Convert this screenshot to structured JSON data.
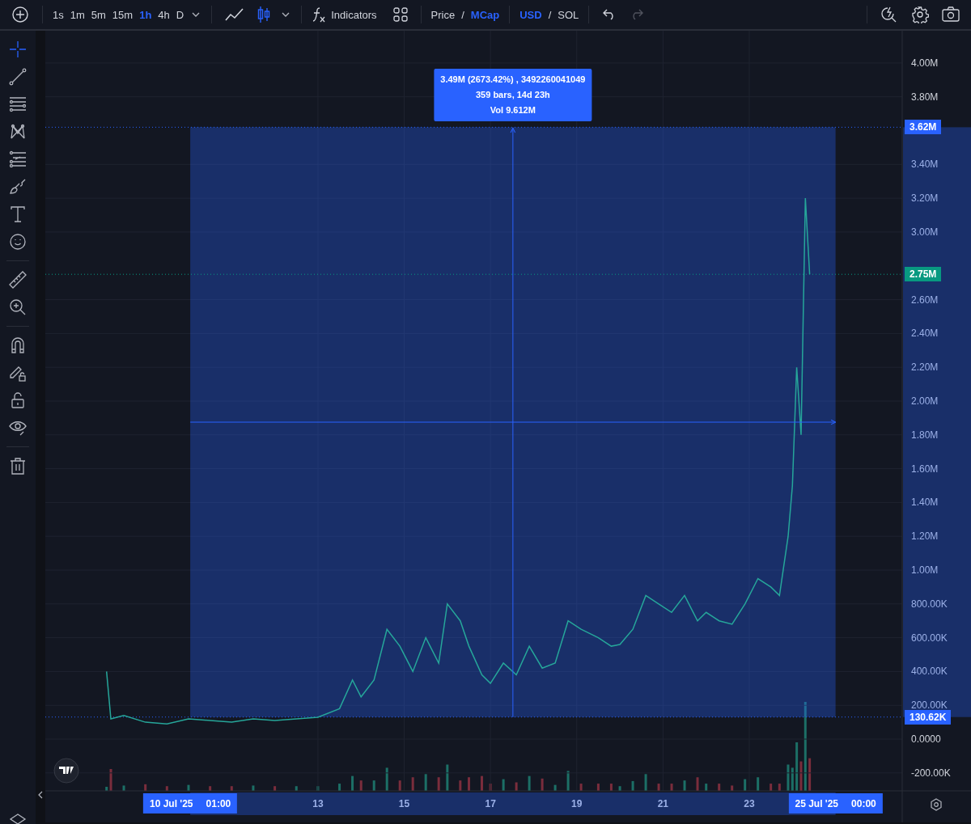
{
  "toolbar": {
    "intervals": [
      {
        "label": "1s",
        "selected": false
      },
      {
        "label": "1m",
        "selected": false
      },
      {
        "label": "5m",
        "selected": false
      },
      {
        "label": "15m",
        "selected": false
      },
      {
        "label": "1h",
        "selected": true
      },
      {
        "label": "4h",
        "selected": false
      },
      {
        "label": "D",
        "selected": false
      }
    ],
    "chart_types": [
      {
        "kind": "line",
        "selected": false
      },
      {
        "kind": "candles",
        "selected": true
      }
    ],
    "indicators_label": "Indicators",
    "value_modes": [
      {
        "label": "Price",
        "selected": false
      },
      {
        "label": "MCap",
        "selected": true
      }
    ],
    "value_separator": "/",
    "currencies": [
      {
        "label": "USD",
        "selected": true
      },
      {
        "label": "SOL",
        "selected": false
      }
    ],
    "currency_separator": "/",
    "undo": {
      "disabled": false
    },
    "redo": {
      "disabled": true
    }
  },
  "tool_groups": [
    [
      {
        "kind": "crosshair",
        "selected": true
      },
      {
        "kind": "trend-line",
        "selected": false
      },
      {
        "kind": "horizontal-lines",
        "selected": false
      },
      {
        "kind": "pattern",
        "selected": false
      },
      {
        "kind": "fib",
        "selected": false
      },
      {
        "kind": "brush",
        "selected": false
      },
      {
        "kind": "text",
        "selected": false
      },
      {
        "kind": "emoji",
        "selected": false
      }
    ],
    [
      {
        "kind": "ruler",
        "selected": false
      },
      {
        "kind": "zoom",
        "selected": false
      }
    ],
    [
      {
        "kind": "magnet",
        "selected": false
      },
      {
        "kind": "lock-drawing",
        "selected": false
      },
      {
        "kind": "lock",
        "selected": false
      },
      {
        "kind": "eye",
        "selected": false
      }
    ],
    [
      {
        "kind": "trash",
        "selected": false
      }
    ]
  ],
  "chart": {
    "chart_data": {
      "type": "line",
      "xlim": [
        6.68,
        28.14
      ],
      "ylim": [
        -492577,
        4191000
      ],
      "xticks": [
        {
          "value": 13,
          "label": "13"
        },
        {
          "value": 15,
          "label": "15"
        },
        {
          "value": 17,
          "label": "17"
        },
        {
          "value": 19,
          "label": "19"
        },
        {
          "value": 21,
          "label": "21"
        },
        {
          "value": 23,
          "label": "23"
        }
      ],
      "yticks": [
        {
          "value": 4000000,
          "label": "4.00M"
        },
        {
          "value": 3800000,
          "label": "3.80M"
        },
        {
          "value": 3400000,
          "label": "3.40M"
        },
        {
          "value": 3200000,
          "label": "3.20M"
        },
        {
          "value": 3000000,
          "label": "3.00M"
        },
        {
          "value": 2600000,
          "label": "2.60M"
        },
        {
          "value": 2400000,
          "label": "2.40M"
        },
        {
          "value": 2200000,
          "label": "2.20M"
        },
        {
          "value": 2000000,
          "label": "2.00M"
        },
        {
          "value": 1800000,
          "label": "1.80M"
        },
        {
          "value": 1600000,
          "label": "1.60M"
        },
        {
          "value": 1400000,
          "label": "1.40M"
        },
        {
          "value": 1200000,
          "label": "1.20M"
        },
        {
          "value": 1000000,
          "label": "1.00M"
        },
        {
          "value": 800000,
          "label": "800.00K"
        },
        {
          "value": 600000,
          "label": "600.00K"
        },
        {
          "value": 400000,
          "label": "400.00K"
        },
        {
          "value": 200000,
          "label": "200.00K"
        },
        {
          "value": 0,
          "label": "0.0000"
        },
        {
          "value": -200000,
          "label": "-200.00K"
        }
      ],
      "x": [
        8.1,
        8.2,
        8.5,
        9,
        9.5,
        10,
        10.5,
        11,
        11.5,
        12,
        12.5,
        13,
        13.5,
        13.8,
        14,
        14.3,
        14.6,
        14.9,
        15.2,
        15.5,
        15.8,
        16,
        16.3,
        16.5,
        16.8,
        17,
        17.3,
        17.6,
        17.9,
        18.2,
        18.5,
        18.8,
        19.1,
        19.5,
        19.8,
        20,
        20.3,
        20.6,
        20.9,
        21.2,
        21.5,
        21.8,
        22,
        22.3,
        22.6,
        22.9,
        23.2,
        23.5,
        23.7,
        23.9,
        24,
        24.1,
        24.2,
        24.3,
        24.4
      ],
      "grid": true,
      "series": [
        {
          "color": "#26a69a",
          "values": [
            400000,
            120000,
            140000,
            100000,
            90000,
            120000,
            110000,
            100000,
            120000,
            110000,
            120000,
            130000,
            180000,
            350000,
            250000,
            350000,
            650000,
            550000,
            400000,
            600000,
            450000,
            800000,
            700000,
            550000,
            380000,
            330000,
            450000,
            380000,
            550000,
            420000,
            450000,
            700000,
            650000,
            600000,
            550000,
            560000,
            650000,
            850000,
            800000,
            750000,
            850000,
            700000,
            750000,
            700000,
            680000,
            800000,
            950000,
            900000,
            850000,
            1200000,
            1500000,
            2200000,
            1800000,
            3200000,
            2750000
          ]
        }
      ],
      "bands": [
        {
          "axis": "x",
          "from": 10.04,
          "to": 25
        }
      ],
      "ref_lines": [
        {
          "axis": "y",
          "value": 3620000,
          "label": "3.62M",
          "color": "#2962ff"
        },
        {
          "axis": "y",
          "value": 2750000,
          "label": "2.75M",
          "color": "#089981"
        },
        {
          "axis": "y",
          "value": 130620,
          "label": "130.62K",
          "color": "#2962ff"
        }
      ]
    },
    "measure_tooltip": [
      "3.49M (2673.42%) , 3492260041049",
      "359 bars, 14d 23h",
      "Vol 9.612M"
    ],
    "time_labels": [
      {
        "date": "10 Jul '25",
        "time": "01:00",
        "kind": "range_start"
      },
      {
        "date": "25 Jul '25",
        "time": "00:00",
        "kind": "range_end"
      }
    ]
  }
}
